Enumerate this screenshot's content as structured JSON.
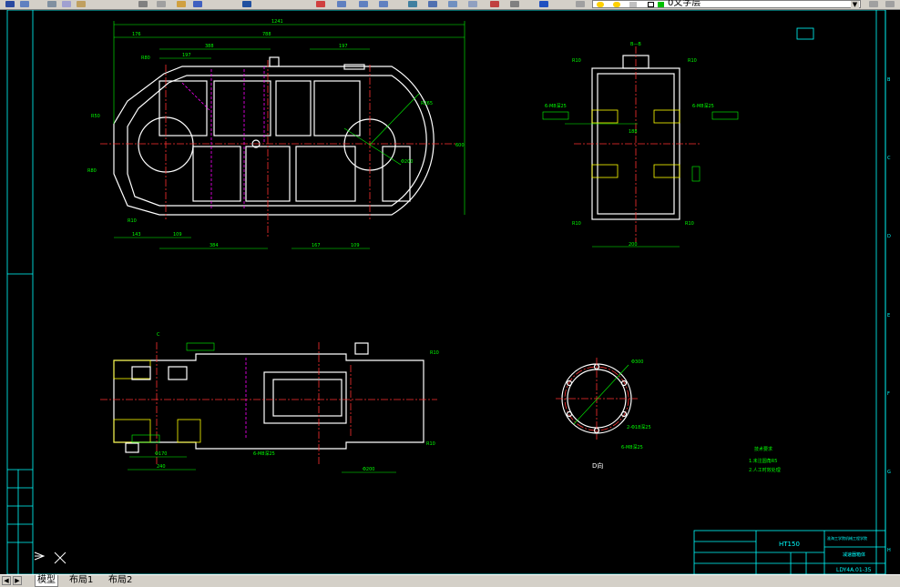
{
  "toolbar": {
    "layer_name": "0文字层"
  },
  "drawing": {
    "overall_length": "1241",
    "dim_176": "176",
    "dim_788": "788",
    "dim_388": "388",
    "dim_197": "197",
    "dim_r80": "R80",
    "dim_r50": "R50",
    "dim_r265": "R265",
    "dim_600": "600",
    "dim_phi200": "Φ200",
    "dim_167": "167",
    "dim_109": "109",
    "dim_384": "384",
    "dim_143": "143",
    "dim_185": "185",
    "section_bb": "B—B",
    "r10": "R10",
    "dim_200": "200",
    "dim_188": "188",
    "m_thread": "6-M8深25",
    "rc": "R10",
    "cview": "C",
    "dview": "D向",
    "dim_240": "240",
    "dim_p170": "Φ170",
    "dim_p200": "Φ200",
    "dim_phi300": "Φ300",
    "holes_2": "2-Φ18深25",
    "holes_6": "6-M8深25",
    "tech_title": "技术要求",
    "tech_1": "1.未注圆角R5",
    "tech_2": "2.人工时效处理",
    "material": "HT150",
    "drawing_no": "LDY4A.01-35",
    "company": "淮海工学院机械工程学院",
    "part_name": "减速器箱体"
  },
  "status": {
    "tab_model": "模型",
    "tab_layout1": "布局1",
    "tab_layout2": "布局2"
  },
  "colors": {
    "background": "#000000",
    "outline": "#ffffff",
    "dimension": "#00ff00",
    "centerline": "#ff0000",
    "hidden": "#ff00ff",
    "frame_text": "#00ffff"
  }
}
